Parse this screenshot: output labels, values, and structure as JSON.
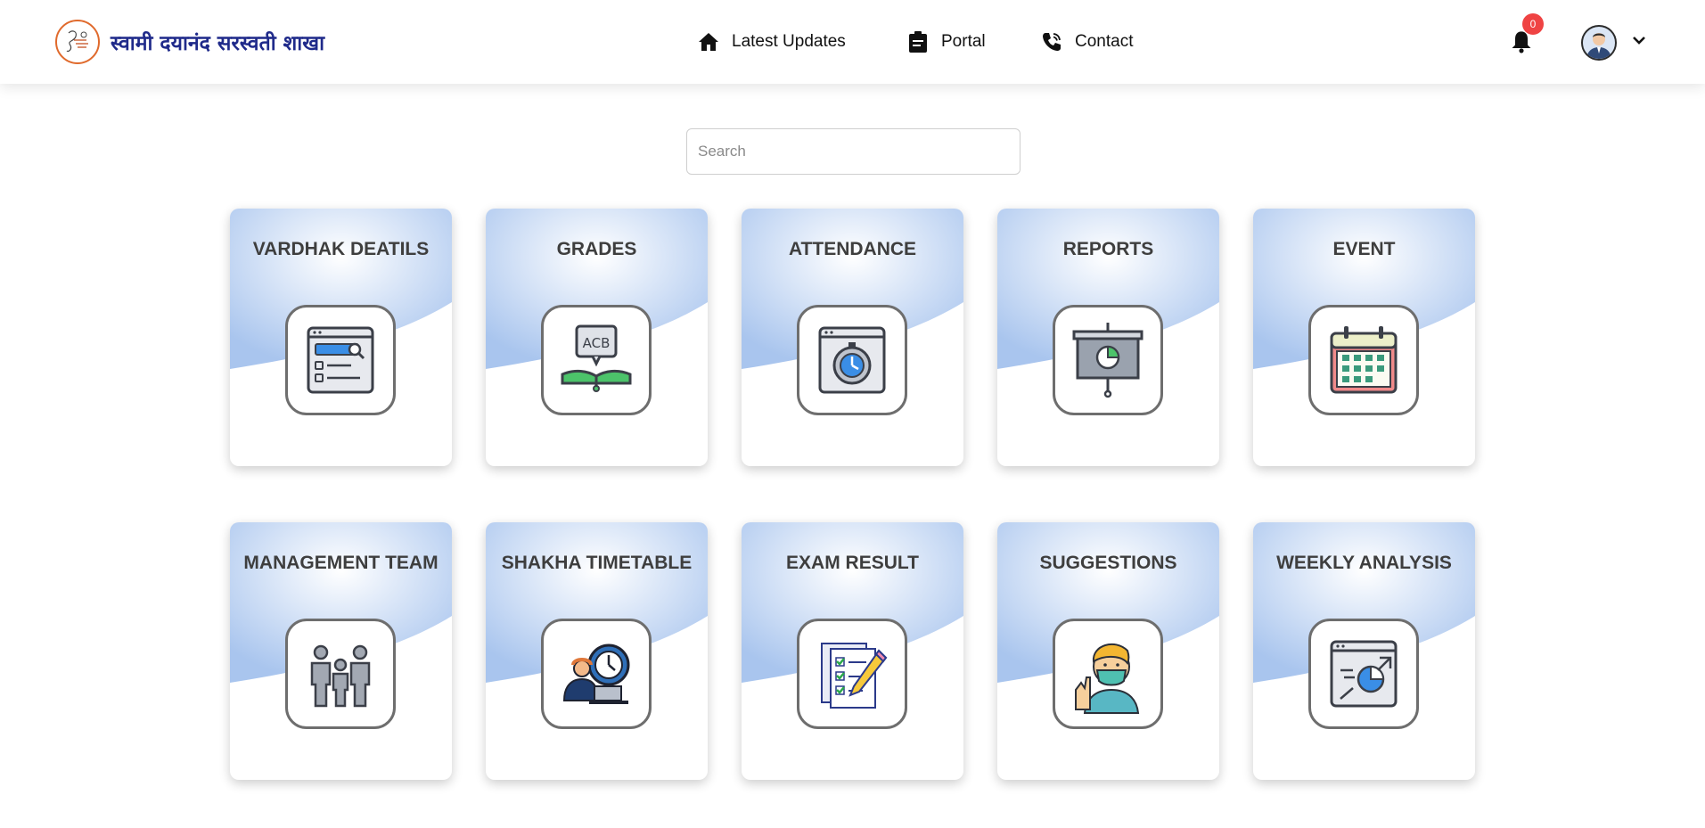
{
  "header": {
    "brand_name": "स्वामी दयानंद सरस्वती शाखा",
    "nav": [
      {
        "label": "Latest Updates",
        "icon": "home-icon"
      },
      {
        "label": "Portal",
        "icon": "clipboard-icon"
      },
      {
        "label": "Contact",
        "icon": "phone-icon"
      }
    ],
    "notification_count": "0"
  },
  "search": {
    "placeholder": "Search",
    "value": ""
  },
  "cards": [
    {
      "title": "VARDHAK DEATILS",
      "icon": "profile-search-icon"
    },
    {
      "title": "GRADES",
      "icon": "grades-book-icon"
    },
    {
      "title": "ATTENDANCE",
      "icon": "stopwatch-icon"
    },
    {
      "title": "REPORTS",
      "icon": "presentation-chart-icon"
    },
    {
      "title": "EVENT",
      "icon": "calendar-icon"
    },
    {
      "title": "MANAGEMENT TEAM",
      "icon": "team-icon"
    },
    {
      "title": "SHAKHA TIMETABLE",
      "icon": "timetable-icon"
    },
    {
      "title": "EXAM RESULT",
      "icon": "exam-checklist-icon"
    },
    {
      "title": "SUGGESTIONS",
      "icon": "person-mask-icon"
    },
    {
      "title": "WEEKLY ANALYSIS",
      "icon": "analysis-chart-icon"
    }
  ],
  "colors": {
    "card_gradient": "#b9d0f0",
    "brand_text": "#1f2a8a",
    "badge": "#ef4343"
  }
}
